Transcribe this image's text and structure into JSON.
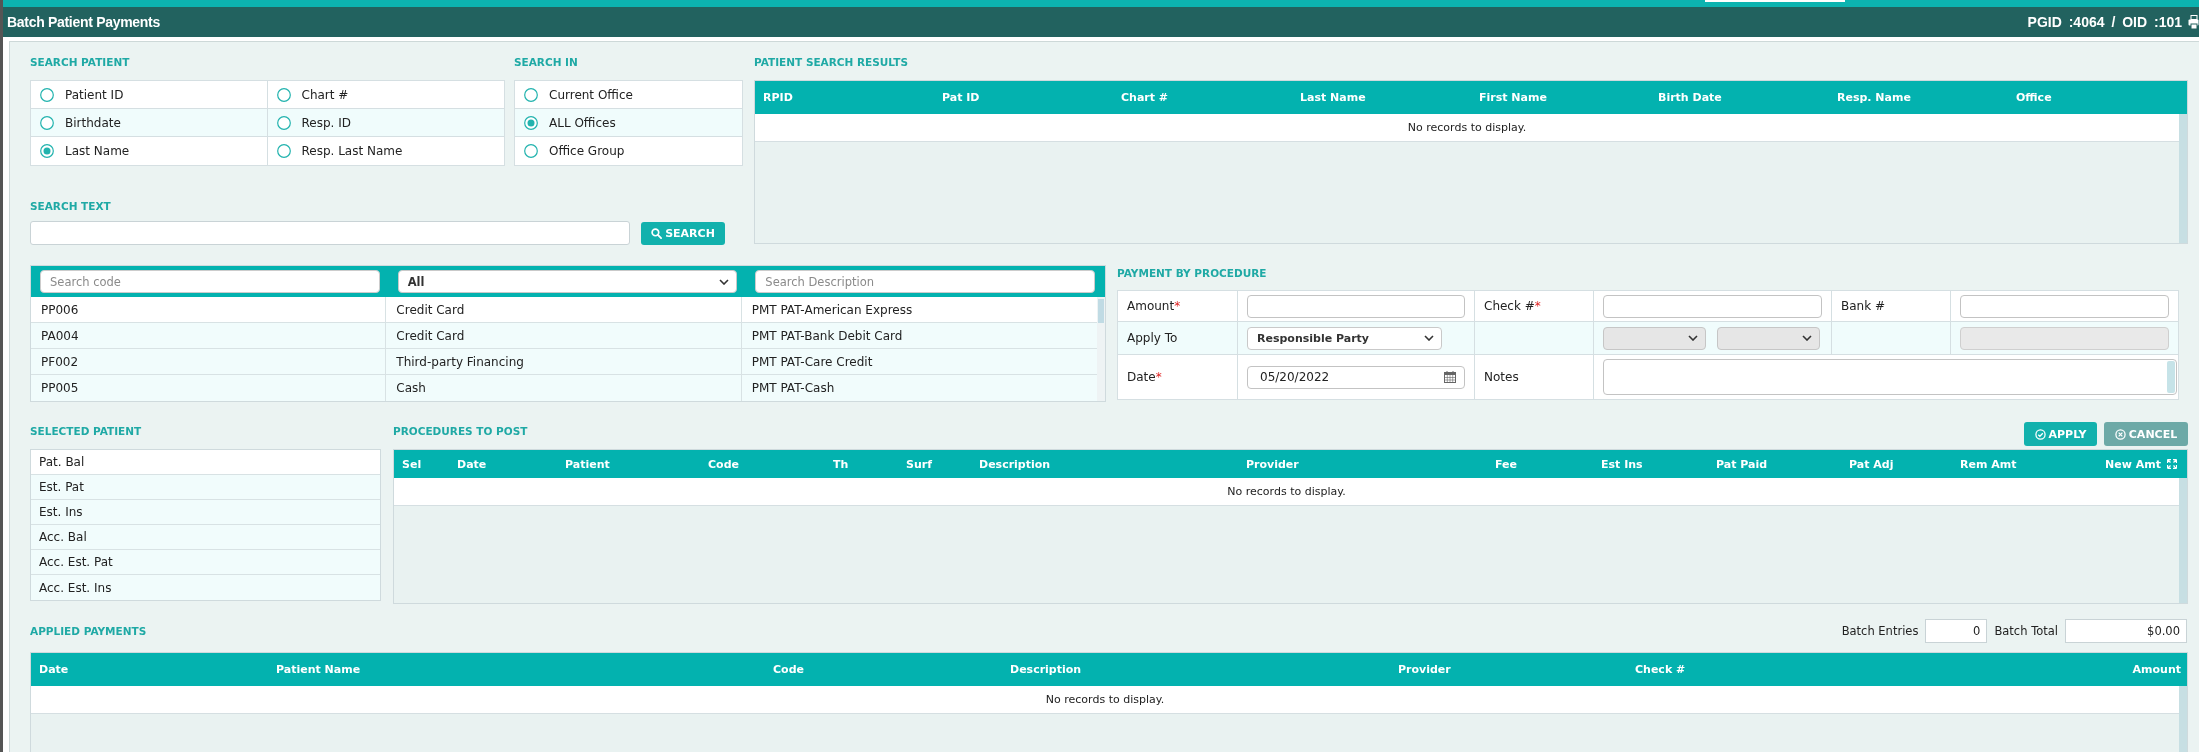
{
  "header": {
    "title": "Batch Patient Payments",
    "ids": "PGID :4064 / OID :101"
  },
  "search_patient": {
    "title": "SEARCH PATIENT",
    "options": [
      {
        "label": "Patient ID",
        "selected": false
      },
      {
        "label": "Chart #",
        "selected": false
      },
      {
        "label": "Birthdate",
        "selected": false
      },
      {
        "label": "Resp. ID",
        "selected": false
      },
      {
        "label": "Last Name",
        "selected": true
      },
      {
        "label": "Resp. Last Name",
        "selected": false
      }
    ]
  },
  "search_in": {
    "title": "SEARCH IN",
    "options": [
      {
        "label": "Current Office",
        "selected": false
      },
      {
        "label": "ALL Offices",
        "selected": true
      },
      {
        "label": "Office Group",
        "selected": false
      }
    ]
  },
  "search_text": {
    "title": "SEARCH TEXT",
    "button": "SEARCH"
  },
  "patient_search_results": {
    "title": "PATIENT SEARCH RESULTS",
    "columns": [
      "RPID",
      "Pat ID",
      "Chart #",
      "Last Name",
      "First Name",
      "Birth Date",
      "Resp. Name",
      "Office"
    ],
    "empty_message": "No records to display."
  },
  "payment_codes": {
    "filters": [
      {
        "kind": "input",
        "placeholder": "Search code"
      },
      {
        "kind": "select",
        "value": "All"
      },
      {
        "kind": "input",
        "placeholder": "Search Description"
      }
    ],
    "rows": [
      [
        "PP006",
        "Credit Card",
        "PMT PAT-American Express"
      ],
      [
        "PA004",
        "Credit Card",
        "PMT PAT-Bank Debit Card"
      ],
      [
        "PF002",
        "Third-party Financing",
        "PMT PAT-Care Credit"
      ],
      [
        "PP005",
        "Cash",
        "PMT PAT-Cash"
      ]
    ]
  },
  "payment_by_procedure": {
    "title": "PAYMENT BY PROCEDURE",
    "rows": [
      [
        {
          "kind": "label",
          "text": "Amount",
          "required_mark": "*"
        },
        {
          "kind": "input",
          "disabled": false
        },
        {
          "kind": "label",
          "text": "Check #",
          "required_mark": "*"
        },
        {
          "kind": "input",
          "disabled": false
        },
        {
          "kind": "label",
          "text": "Bank #"
        },
        {
          "kind": "input",
          "disabled": false
        }
      ],
      [
        {
          "kind": "label",
          "text": "Apply To"
        },
        {
          "kind": "select",
          "value": "Responsible Party",
          "disabled": false
        },
        {
          "kind": "blank"
        },
        {
          "kind": "select_pair",
          "disabled": true
        },
        {
          "kind": "blank"
        },
        {
          "kind": "input",
          "disabled": true
        }
      ],
      [
        {
          "kind": "label",
          "text": "Date",
          "required_mark": "*"
        },
        {
          "kind": "date",
          "value": "05/20/2022",
          "disabled": false
        },
        {
          "kind": "label",
          "text": "Notes"
        },
        {
          "kind": "textarea",
          "disabled": false
        }
      ]
    ]
  },
  "selected_patient": {
    "title": "SELECTED PATIENT",
    "rows": [
      "Pat. Bal",
      "Est. Pat",
      "Est. Ins",
      "Acc. Bal",
      "Acc. Est. Pat",
      "Acc. Est. Ins"
    ]
  },
  "procedures_to_post": {
    "title": "PROCEDURES TO POST",
    "buttons": [
      {
        "kind": "apply",
        "label": "APPLY"
      },
      {
        "kind": "cancel",
        "label": "CANCEL"
      }
    ],
    "columns": [
      "Sel",
      "Date",
      "Patient",
      "Code",
      "Th",
      "Surf",
      "Description",
      "Provider",
      "Fee",
      "Est Ins",
      "Pat Paid",
      "Pat Adj",
      "Rem Amt",
      "New Amt"
    ],
    "empty_message": "No records to display."
  },
  "applied_payments": {
    "title": "APPLIED PAYMENTS",
    "batch_entries": {
      "label": "Batch Entries",
      "value": "0"
    },
    "batch_total": {
      "label": "Batch Total",
      "value": "$0.00"
    },
    "columns": [
      "Date",
      "Patient Name",
      "Code",
      "Description",
      "Provider",
      "Check #",
      "Amount"
    ],
    "empty_message": "No records to display."
  }
}
